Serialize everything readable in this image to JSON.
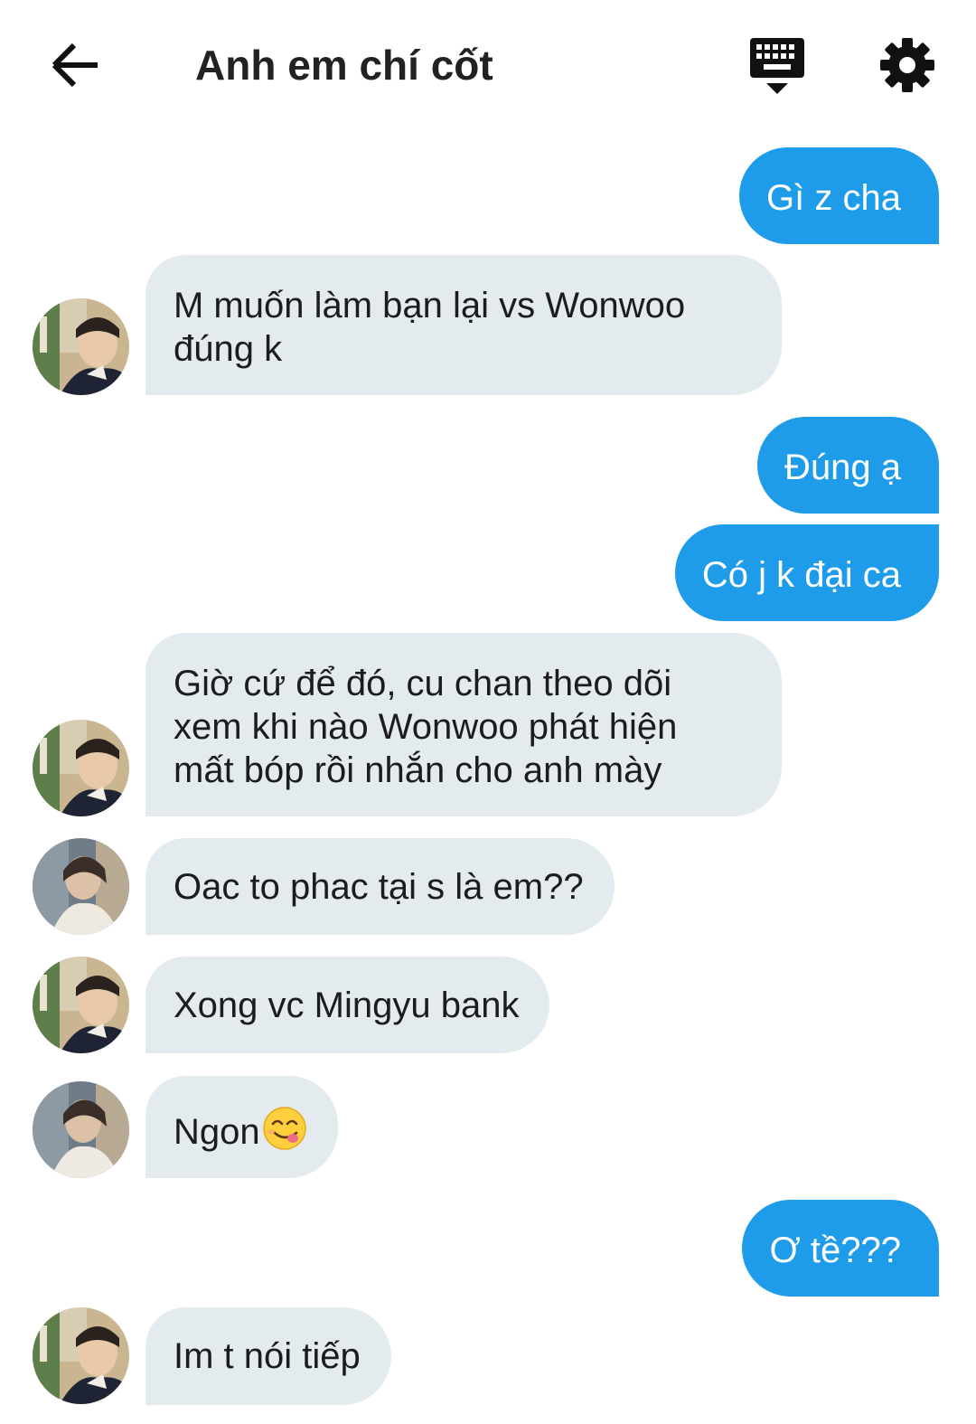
{
  "header": {
    "title": "Anh em chí cốt",
    "back_icon": "arrow-left-icon",
    "keyboard_icon": "keyboard-icon",
    "settings_icon": "gear-icon"
  },
  "colors": {
    "outgoing_bubble": "#1e9be9",
    "incoming_bubble": "#e4ebee",
    "background": "#ffffff"
  },
  "messages": [
    {
      "direction": "out",
      "text": "Gì z cha"
    },
    {
      "direction": "in",
      "sender": "A",
      "lines": [
        "M muốn làm bạn lại vs Wonwoo",
        "đúng k"
      ]
    },
    {
      "direction": "out",
      "text": "Đúng ạ"
    },
    {
      "direction": "out",
      "text": "Có j k đại ca"
    },
    {
      "direction": "in",
      "sender": "A",
      "lines": [
        "Giờ cứ để đó, cu chan theo dõi",
        "xem khi nào Wonwoo phát hiện",
        "mất bóp rồi nhắn cho anh mày"
      ]
    },
    {
      "direction": "in",
      "sender": "B",
      "text": "Oac to phac tại s là em??"
    },
    {
      "direction": "in",
      "sender": "A",
      "text": "Xong vc Mingyu bank"
    },
    {
      "direction": "in",
      "sender": "B",
      "text": "Ngon",
      "emoji": "yum-face-emoji"
    },
    {
      "direction": "out",
      "text": "Ơ tề???"
    },
    {
      "direction": "in",
      "sender": "A",
      "text": "Im t nói tiếp"
    }
  ]
}
